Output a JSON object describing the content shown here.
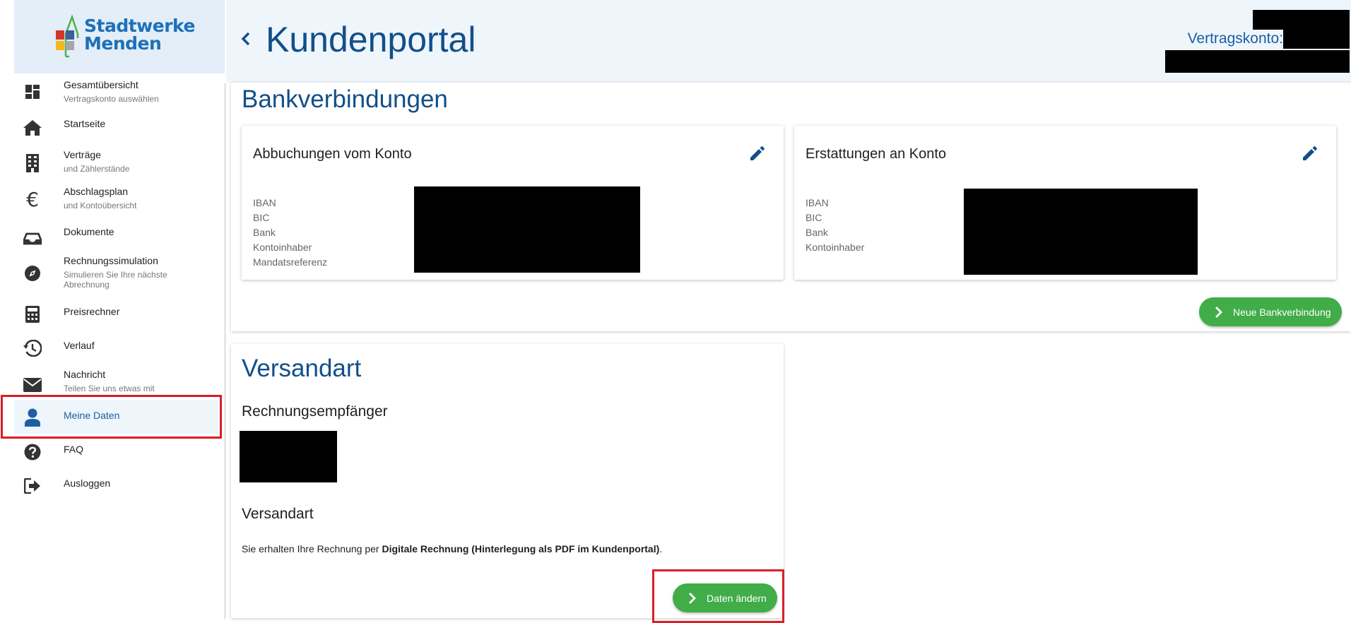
{
  "brand": {
    "line1": "Stadtwerke",
    "line2": "Menden",
    "colors": {
      "blue": "#1d70b8",
      "red": "#d9342b",
      "yellow": "#f3b81c",
      "grey": "#a6a6a6",
      "navy": "#3b5f9e",
      "green": "#4caf50"
    }
  },
  "header": {
    "title": "Kundenportal",
    "account_label": "Vertragskonto:"
  },
  "sidebar": {
    "items": [
      {
        "label": "Gesamtübersicht",
        "sub": "Vertragskonto auswählen",
        "icon": "dashboard-icon"
      },
      {
        "label": "Startseite",
        "sub": "",
        "icon": "home-icon"
      },
      {
        "label": "Verträge",
        "sub": "und Zählerstände",
        "icon": "building-icon"
      },
      {
        "label": "Abschlagsplan",
        "sub": "und Kontoübersicht",
        "icon": "euro-icon"
      },
      {
        "label": "Dokumente",
        "sub": "",
        "icon": "inbox-icon"
      },
      {
        "label": "Rechnungssimulation",
        "sub": "Simulieren Sie Ihre nächste Abrechnung",
        "icon": "compass-icon"
      },
      {
        "label": "Preisrechner",
        "sub": "",
        "icon": "calculator-icon"
      },
      {
        "label": "Verlauf",
        "sub": "",
        "icon": "history-icon"
      },
      {
        "label": "Nachricht",
        "sub": "Teilen Sie uns etwas mit",
        "icon": "mail-icon"
      },
      {
        "label": "Meine Daten",
        "sub": "",
        "icon": "person-icon",
        "active": true
      },
      {
        "label": "FAQ",
        "sub": "",
        "icon": "help-icon"
      },
      {
        "label": "Ausloggen",
        "sub": "",
        "icon": "logout-icon"
      }
    ]
  },
  "bank": {
    "title": "Bankverbindungen",
    "debit": {
      "title": "Abbuchungen vom Konto",
      "fields": [
        "IBAN",
        "BIC",
        "Bank",
        "Kontoinhaber",
        "Mandatsreferenz"
      ]
    },
    "refund": {
      "title": "Erstattungen an Konto",
      "fields": [
        "IBAN",
        "BIC",
        "Bank",
        "Kontoinhaber"
      ]
    },
    "new_button": "Neue Bankverbindung"
  },
  "shipping": {
    "title": "Versandart",
    "recipient_heading": "Rechnungsempfänger",
    "method_heading": "Versandart",
    "text_prefix": "Sie erhalten Ihre Rechnung per ",
    "text_bold": "Digitale Rechnung (Hinterlegung als PDF im Kundenportal)",
    "text_suffix": ".",
    "change_button": "Daten ändern"
  },
  "theme": {
    "accent": "#124f89",
    "button_green": "#40ad48",
    "header_bg": "#eef5fb",
    "highlight": "#d72027"
  }
}
